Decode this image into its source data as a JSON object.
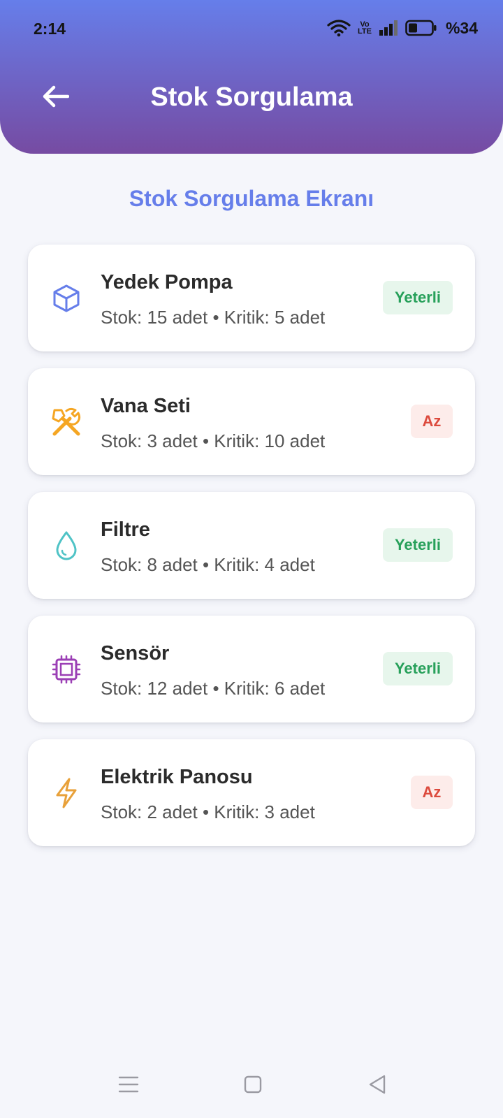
{
  "status_bar": {
    "time": "2:14",
    "battery": "%34",
    "network_label_top": "Vo",
    "network_label_bottom": "LTE"
  },
  "header": {
    "title": "Stok Sorgulama"
  },
  "subtitle": "Stok Sorgulama Ekranı",
  "items": [
    {
      "name": "Yedek Pompa",
      "detail": "Stok: 15 adet • Kritik: 5 adet",
      "status": "Yeterli",
      "status_type": "ok",
      "icon": "box-icon",
      "icon_color": "#667eea"
    },
    {
      "name": "Vana Seti",
      "detail": "Stok: 3 adet • Kritik: 10 adet",
      "status": "Az",
      "status_type": "low",
      "icon": "tools-icon",
      "icon_color": "#f5a623"
    },
    {
      "name": "Filtre",
      "detail": "Stok: 8 adet • Kritik: 4 adet",
      "status": "Yeterli",
      "status_type": "ok",
      "icon": "water-drop-icon",
      "icon_color": "#4fc3c6"
    },
    {
      "name": "Sensör",
      "detail": "Stok: 12 adet • Kritik: 6 adet",
      "status": "Yeterli",
      "status_type": "ok",
      "icon": "chip-icon",
      "icon_color": "#9b3fb5"
    },
    {
      "name": "Elektrik Panosu",
      "detail": "Stok: 2 adet • Kritik: 3 adet",
      "status": "Az",
      "status_type": "low",
      "icon": "lightning-icon",
      "icon_color": "#e8a13a"
    }
  ],
  "colors": {
    "header_gradient_start": "#667eea",
    "header_gradient_end": "#764ba2",
    "ok_text": "#27a05a",
    "ok_bg": "#e7f6ec",
    "low_text": "#dc4a3d",
    "low_bg": "#fdecea"
  }
}
